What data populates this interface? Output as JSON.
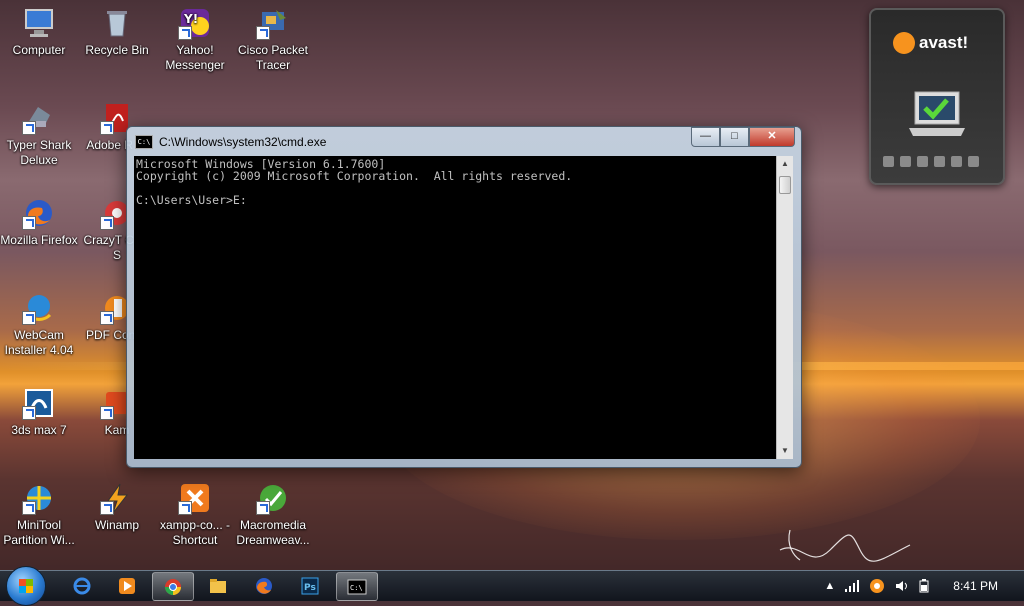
{
  "desktop": {
    "icons": [
      {
        "label": "Computer",
        "icon": "computer-icon"
      },
      {
        "label": "Recycle Bin",
        "icon": "recycle-bin-icon"
      },
      {
        "label": "Yahoo! Messenger",
        "icon": "yahoo-messenger-icon"
      },
      {
        "label": "Cisco Packet Tracer",
        "icon": "cisco-packet-tracer-icon"
      },
      {
        "label": "Typer Shark Deluxe",
        "icon": "typer-shark-icon"
      },
      {
        "label": "Adobe R XI",
        "icon": "adobe-reader-icon"
      },
      {
        "label": "Mozilla Firefox",
        "icon": "firefox-icon"
      },
      {
        "label": "CrazyT Cam S",
        "icon": "crazytalk-icon"
      },
      {
        "label": "WebCam Installer 4.04",
        "icon": "webcam-installer-icon"
      },
      {
        "label": "PDF Conve",
        "icon": "pdf-converter-icon"
      },
      {
        "label": "3ds max 7",
        "icon": "3ds-max-icon"
      },
      {
        "label": "Kam",
        "icon": "kamtasia-icon"
      },
      {
        "label": "MiniTool Partition Wi...",
        "icon": "minitool-icon"
      },
      {
        "label": "Winamp",
        "icon": "winamp-icon"
      },
      {
        "label": "xampp-co... - Shortcut",
        "icon": "xampp-icon"
      },
      {
        "label": "Macromedia Dreamweav...",
        "icon": "dreamweaver-icon"
      }
    ]
  },
  "cmd": {
    "title": "C:\\Windows\\system32\\cmd.exe",
    "lines": [
      "Microsoft Windows [Version 6.1.7600]",
      "Copyright (c) 2009 Microsoft Corporation.  All rights reserved.",
      "",
      "C:\\Users\\User>E:"
    ]
  },
  "avast": {
    "brand": "avast!"
  },
  "taskbar": {
    "items": [
      "ie-icon",
      "media-icon",
      "chrome-icon",
      "explorer-icon",
      "firefox-icon",
      "photoshop-icon",
      "cmd-icon"
    ],
    "clock": "8:41 PM"
  },
  "colors": {
    "console_bg": "#000000",
    "console_text": "#c0c0c0",
    "avast_orange": "#f7931e"
  }
}
